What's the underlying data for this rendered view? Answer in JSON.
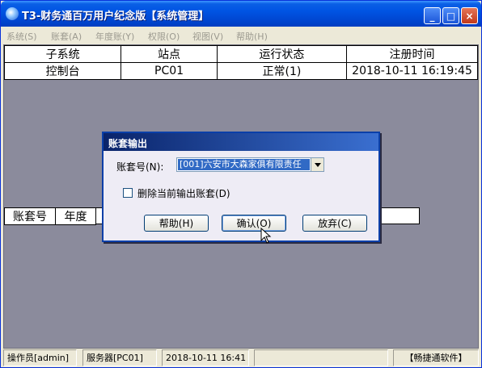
{
  "window": {
    "title": "T3-财务通百万用户纪念版【系统管理】",
    "controls": [
      "_",
      "□",
      "×"
    ]
  },
  "menu": [
    "系统(S)",
    "账套(A)",
    "年度账(Y)",
    "权限(O)",
    "视图(V)",
    "帮助(H)"
  ],
  "top_table": {
    "headers": [
      "子系统",
      "站点",
      "运行状态",
      "注册时间"
    ],
    "rows": [
      [
        "控制台",
        "PC01",
        "正常(1)",
        "2018-10-11 16:19:45"
      ]
    ]
  },
  "account_table": {
    "headers": [
      "账套号",
      "年度"
    ]
  },
  "dialog": {
    "title": "账套输出",
    "account_label": "账套号(N):",
    "account_value": "[001]六安市大森家俱有限责任",
    "checkbox_label": "删除当前输出账套(D)",
    "help_button": "帮助(H)",
    "ok_button": "确认(O)",
    "cancel_button": "放弃(C)"
  },
  "status": {
    "operator": "操作员[admin]",
    "server": "服务器[PC01]",
    "datetime": "2018-10-11 16:41",
    "brand": "【畅捷通软件】"
  }
}
